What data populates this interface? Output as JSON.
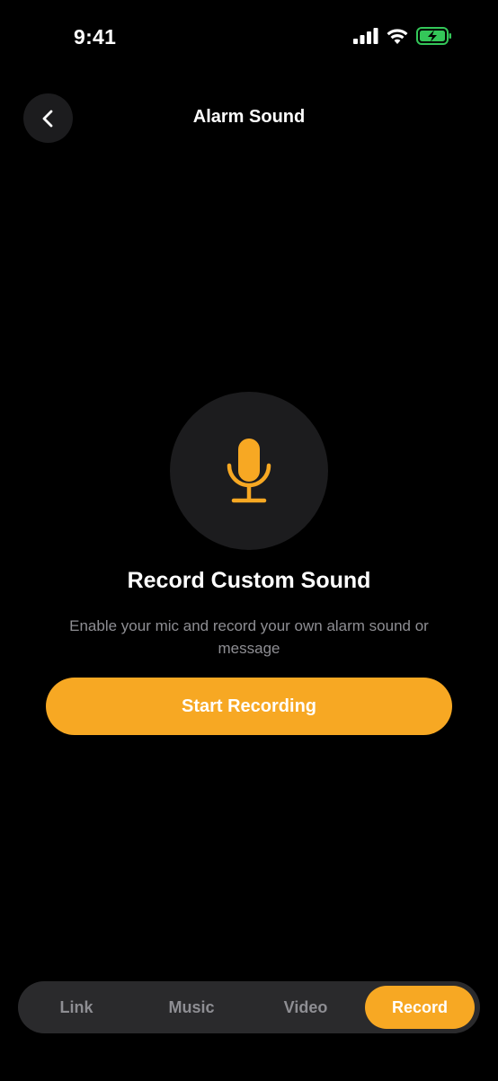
{
  "status_bar": {
    "time": "9:41"
  },
  "header": {
    "title": "Alarm Sound"
  },
  "main": {
    "title": "Record Custom Sound",
    "description": "Enable your mic and record your own alarm sound or message",
    "start_label": "Start Recording"
  },
  "tabs": [
    {
      "label": "Link",
      "active": false
    },
    {
      "label": "Music",
      "active": false
    },
    {
      "label": "Video",
      "active": false
    },
    {
      "label": "Record",
      "active": true
    }
  ],
  "colors": {
    "accent": "#f7a823",
    "background": "#000000",
    "surface": "#1c1c1e",
    "battery": "#34c759"
  },
  "icons": [
    "signal-icon",
    "wifi-icon",
    "battery-icon",
    "back-chevron-icon",
    "microphone-icon"
  ]
}
